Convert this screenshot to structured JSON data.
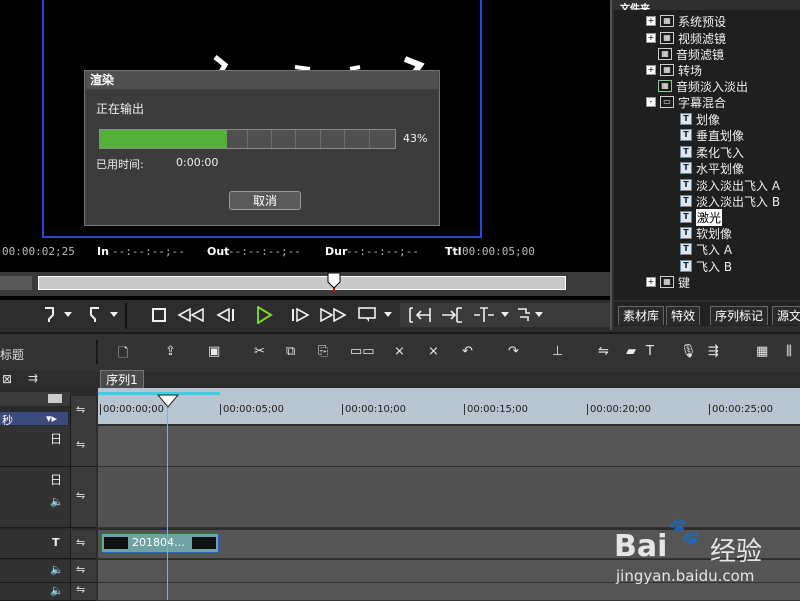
{
  "preview": {
    "timecode": "00:00:02;25",
    "in_label": "In",
    "in_value": "--:--:--;--",
    "out_label": "Out",
    "out_value": "--:--:--;--",
    "dur_label": "Dur",
    "dur_value": "--:--:--;--",
    "ttl_label": "Ttl",
    "ttl_value": "00:00:05;00",
    "scrub_position": 0.56
  },
  "render_dialog": {
    "title": "渲染",
    "status": "正在输出",
    "progress_percent": 43,
    "progress_text": "43%",
    "elapsed_label": "已用时间:",
    "elapsed_value": "0:00:00",
    "cancel_label": "取消",
    "progress_color": "#55b03a"
  },
  "library": {
    "header": "文件夹",
    "tree": [
      {
        "label": "系统预设",
        "expander": "+",
        "icon": "folder-grid-icon"
      },
      {
        "label": "视频滤镜",
        "expander": "+",
        "icon": "folder-grid-icon"
      },
      {
        "label": "音频滤镜",
        "expander": "",
        "icon": "folder-grid-icon"
      },
      {
        "label": "转场",
        "expander": "+",
        "icon": "folder-grid-icon"
      },
      {
        "label": "音频淡入淡出",
        "expander": "",
        "icon": "folder-grid-icon"
      },
      {
        "label": "字幕混合",
        "expander": "-",
        "icon": "open-folder-icon"
      },
      {
        "label": "划像",
        "icon": "title-effect-icon"
      },
      {
        "label": "垂直划像",
        "icon": "title-effect-icon"
      },
      {
        "label": "柔化飞入",
        "icon": "title-effect-icon"
      },
      {
        "label": "水平划像",
        "icon": "title-effect-icon"
      },
      {
        "label": "淡入淡出飞入 A",
        "icon": "title-effect-icon"
      },
      {
        "label": "淡入淡出飞入 B",
        "icon": "title-effect-icon"
      },
      {
        "label": "激光",
        "icon": "title-effect-icon",
        "selected": true
      },
      {
        "label": "软划像",
        "icon": "title-effect-icon"
      },
      {
        "label": "飞入 A",
        "icon": "title-effect-icon"
      },
      {
        "label": "飞入 B",
        "icon": "title-effect-icon"
      },
      {
        "label": "键",
        "expander": "+",
        "icon": "folder-grid-icon"
      }
    ],
    "tabs": [
      "素材库",
      "特效",
      "序列标记",
      "源文"
    ]
  },
  "timeline": {
    "sequence_tab": "序列1",
    "header_label": "标题",
    "scale_unit": "秒",
    "ruler_ticks": [
      "00:00:00;00",
      "00:00:05;00",
      "00:00:10;00",
      "00:00:15;00",
      "00:00:20;00",
      "00:00:25;00"
    ],
    "clip_label": "201804…",
    "track_marks": [
      "日",
      "日",
      "T"
    ]
  },
  "watermark": {
    "brand": "Bai",
    "brand_cn": "经验",
    "url": "jingyan.baidu.com"
  }
}
